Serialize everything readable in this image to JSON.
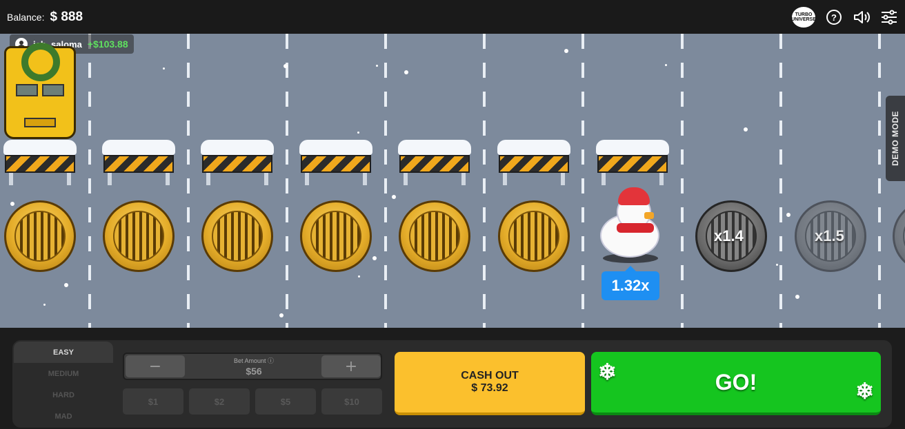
{
  "header": {
    "balance_label": "Balance:",
    "balance_value": "$ 888",
    "logo_text": "TURBO UNIVERSE"
  },
  "player": {
    "name": "jeb_saloma",
    "win": "+$103.88"
  },
  "board": {
    "current_multiplier": "1.32x",
    "next_multipliers": [
      "x1.4",
      "x1.5"
    ],
    "demo_label": "DEMO MODE"
  },
  "controls": {
    "difficulties": [
      "EASY",
      "MEDIUM",
      "HARD",
      "MAD"
    ],
    "active_difficulty": "EASY",
    "bet_label": "Bet Amount",
    "bet_value": "$56",
    "minus": "−",
    "plus": "+",
    "quick_bets": [
      "$1",
      "$2",
      "$5",
      "$10"
    ],
    "cashout_label": "CASH OUT",
    "cashout_value": "$ 73.92",
    "go_label": "GO!"
  },
  "colors": {
    "accent_green": "#15c51f",
    "cashout_yellow": "#fbc02d",
    "multiplier_blue": "#1e8ff2",
    "road": "#7d8a9c"
  }
}
